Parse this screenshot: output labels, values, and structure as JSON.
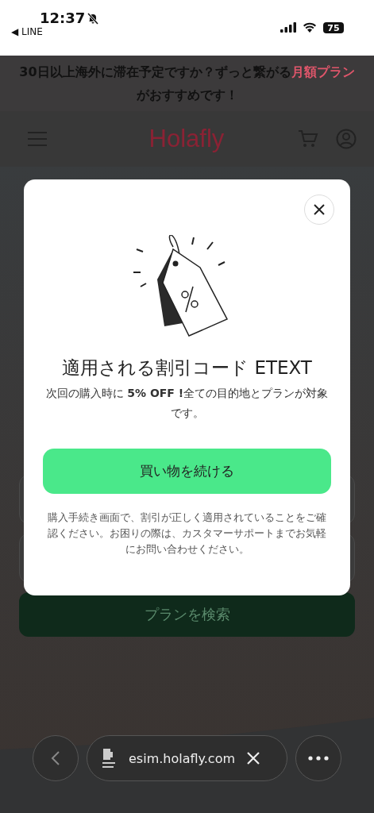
{
  "status_bar": {
    "time": "12:37",
    "back_app": "◀ LINE",
    "battery": "75"
  },
  "banner": {
    "parts": [
      {
        "text": "30日以上海外に滞在予定ですか？ずっと繋がる",
        "highlight": false
      },
      {
        "text": "月額プラン",
        "highlight": true
      },
      {
        "text": "がおすすめです！",
        "highlight": false
      }
    ]
  },
  "header": {
    "logo": "Holafly"
  },
  "form": {
    "fields": [
      {
        "kind": "field"
      },
      {
        "kind": "field"
      }
    ],
    "button": "プランを検索"
  },
  "modal": {
    "title": "適用される割引コード ETEXT",
    "message": "次回の購入時に **5% OFF !**全ての目的地とプランが対象です。",
    "button": "買い物を続ける",
    "note": "購入手続き画面で、割引が正しく適用されていることをご確認ください。お困りの際は、カスタマーサポートまでお気軽にお問い合わせください。"
  },
  "browser_bar": {
    "url": "esim.holafly.com"
  }
}
